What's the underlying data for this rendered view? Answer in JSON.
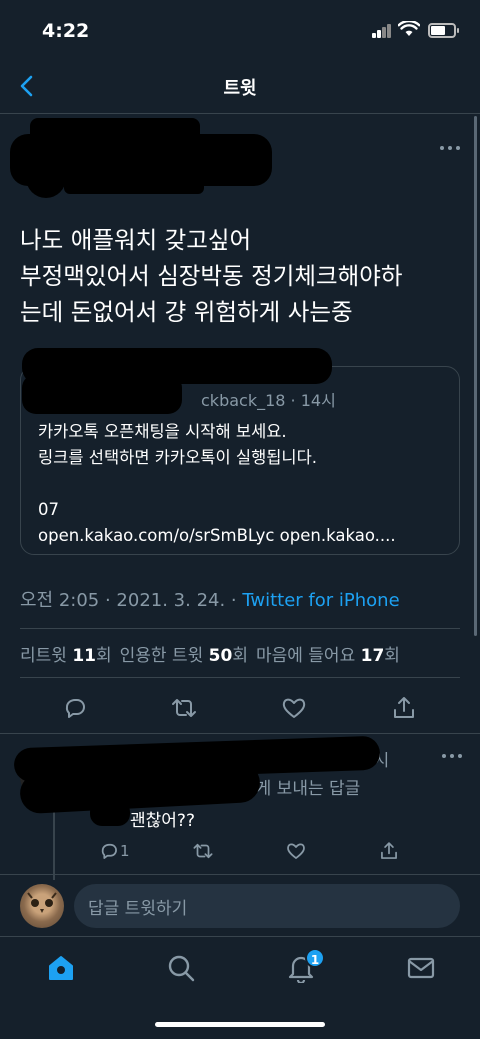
{
  "status_bar": {
    "time": "4:22"
  },
  "header": {
    "title": "트윗"
  },
  "tweet": {
    "text_lines": [
      "나도 애플워치 갖고싶어",
      "부정맥있어서 심장박동 정기체크해야하",
      "는데 돈없어서 걍 위험하게 사는중"
    ],
    "timestamp": "오전 2:05 · 2021. 3. 24. · ",
    "source": "Twitter for iPhone"
  },
  "quote": {
    "handle_partial": "ckback_18 · 14시",
    "body_lines": [
      "카카오톡 오픈채팅을 시작해 보세요.",
      "링크를 선택하면 카카오톡이 실행됩니다.",
      "",
      "07",
      "open.kakao.com/o/srSmBLyc open.kakao...."
    ]
  },
  "stats": {
    "retweets_label": "리트윗",
    "retweets_count": "11",
    "retweets_unit": "회",
    "quotes_label": "인용한 트윗",
    "quotes_count": "50",
    "quotes_unit": "회",
    "likes_label": "마음에 들어요",
    "likes_count": "17",
    "likes_unit": "회"
  },
  "reply": {
    "time": "14시",
    "context": "에게 보내는 답글",
    "text": "괜찮어??",
    "reply_count": "1"
  },
  "compose": {
    "placeholder": "답글 트윗하기"
  },
  "tabbar": {
    "notifications_badge": "1"
  },
  "colors": {
    "background": "#15202b",
    "accent": "#1da1f2",
    "muted": "#8899a6",
    "border": "#38444d"
  }
}
